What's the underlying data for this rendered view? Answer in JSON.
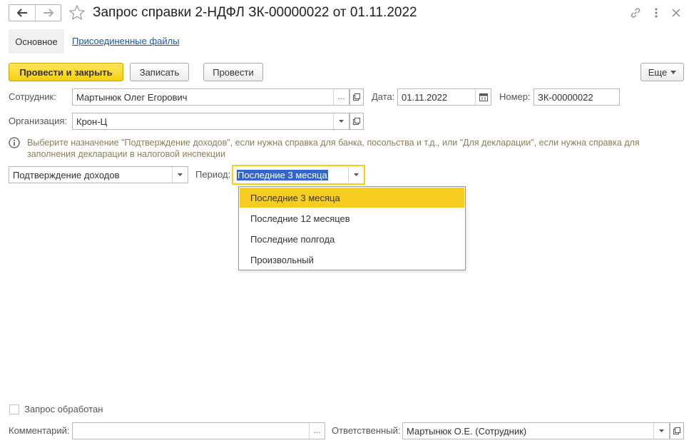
{
  "window": {
    "title": "Запрос справки 2-НДФЛ ЗК-00000022 от 01.11.2022"
  },
  "tabs": {
    "main": "Основное",
    "files": "Присоединенные файлы"
  },
  "toolbar": {
    "post_and_close": "Провести и закрыть",
    "save": "Записать",
    "post": "Провести",
    "more": "Еще"
  },
  "form": {
    "employee_label": "Сотрудник:",
    "employee_value": "Мартынюк Олег Егорович",
    "date_label": "Дата:",
    "date_value": "01.11.2022",
    "number_label": "Номер:",
    "number_value": "ЗК-00000022",
    "organization_label": "Организация:",
    "organization_value": "Крон-Ц",
    "hint": "Выберите назначение \"Подтверждение доходов\", если нужна справка для банка, посольства и т.д., или \"Для декларации\", если нужна справка для заполнения декларации в налоговой инспекции",
    "purpose_value": "Подтверждение доходов",
    "period_label": "Период:",
    "period_value": "Последние 3 месяца",
    "processed_label": "Запрос обработан",
    "processed_checked": false,
    "comment_label": "Комментарий:",
    "comment_value": "",
    "responsible_label": "Ответственный:",
    "responsible_value": "Мартынюк О.Е. (Сотрудник)"
  },
  "period_dropdown": {
    "options": [
      "Последние 3 месяца",
      "Последние 12 месяцев",
      "Последние полгода",
      "Произвольный"
    ],
    "selected_index": 0
  },
  "colors": {
    "primary_button": "#f5cf10",
    "dropdown_highlight": "#f8cd22",
    "link": "#1a55a8",
    "selection": "#3465c8",
    "hint_text": "#8b7d55"
  }
}
